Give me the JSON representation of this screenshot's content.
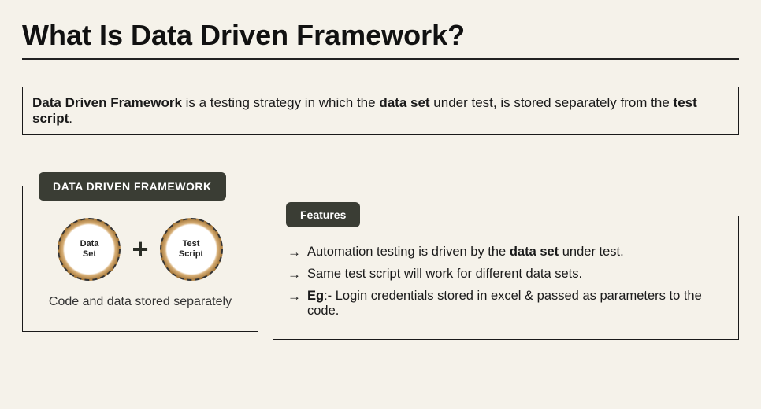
{
  "title": "What Is Data Driven Framework?",
  "definition": {
    "bold1": "Data Driven Framework",
    "mid1": " is a testing strategy in which the ",
    "bold2": "data set",
    "mid2": " under test, is stored separately from the ",
    "bold3": "test script",
    "end": "."
  },
  "ddf": {
    "badge": "DATA DRIVEN FRAMEWORK",
    "circle1_line1": "Data",
    "circle1_line2": "Set",
    "plus": "+",
    "circle2_line1": "Test",
    "circle2_line2": "Script",
    "caption": "Code and data stored separately"
  },
  "features": {
    "badge": "Features",
    "arrow": "→",
    "items": [
      {
        "pre": "Automation testing is driven by the ",
        "bold": "data set",
        "post": " under test."
      },
      {
        "pre": "Same test script will work for different data sets.",
        "bold": "",
        "post": ""
      },
      {
        "preBold": "Eg",
        "pre": ":- Login credentials stored in excel & passed as parameters to the code.",
        "bold": "",
        "post": ""
      }
    ]
  }
}
